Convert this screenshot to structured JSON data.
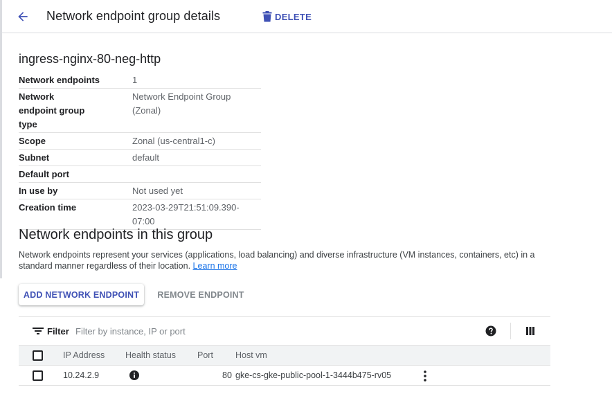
{
  "header": {
    "back_icon": "arrow-back-icon",
    "title": "Network endpoint group details",
    "delete_label": "DELETE",
    "delete_icon": "trash-icon",
    "accent_color": "#3f51b5"
  },
  "resource": {
    "name": "ingress-nginx-80-neg-http"
  },
  "details": [
    {
      "key": "Network endpoints",
      "value": "1"
    },
    {
      "key": "Network endpoint group type",
      "value": "Network Endpoint Group (Zonal)"
    },
    {
      "key": "Scope",
      "value": "Zonal (us-central1-c)"
    },
    {
      "key": "Subnet",
      "value": "default"
    },
    {
      "key": "Default port",
      "value": ""
    },
    {
      "key": "In use by",
      "value": "Not used yet"
    },
    {
      "key": "Creation time",
      "value": "2023-03-29T21:51:09.390-07:00"
    }
  ],
  "section": {
    "title": "Network endpoints in this group",
    "description": "Network endpoints represent your services (applications, load balancing) and diverse infrastructure (VM instances, containers, etc) in a standard manner regardless of their location.",
    "learn_more": "Learn more",
    "add_button": "ADD NETWORK ENDPOINT",
    "remove_button": "REMOVE ENDPOINT"
  },
  "table": {
    "filter_label": "Filter",
    "filter_placeholder": "Filter by instance, IP or port",
    "filter_icon": "filter-list-icon",
    "help_icon": "help-icon",
    "columns_icon": "column-display-icon",
    "columns": [
      "IP Address",
      "Health status",
      "Port",
      "Host vm"
    ],
    "rows": [
      {
        "ip": "10.24.2.9",
        "health_icon": "info-icon",
        "port": "80",
        "host_vm": "gke-cs-gke-public-pool-1-3444b475-rv05"
      }
    ]
  }
}
